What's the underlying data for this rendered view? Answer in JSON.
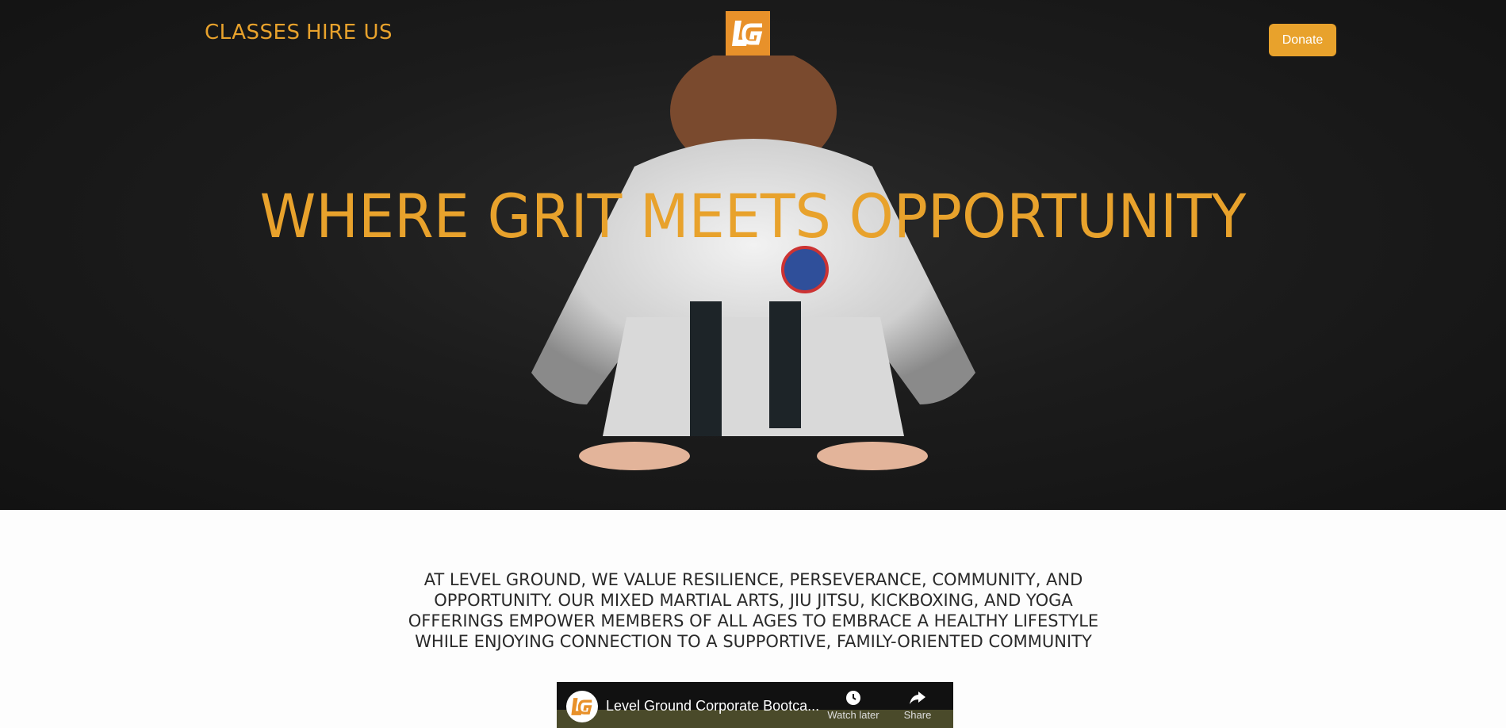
{
  "nav": {
    "classes_label": "CLASSES",
    "hire_label": "HIRE US",
    "donate_label": "Donate"
  },
  "logo": {
    "text": "LG",
    "icon": "lg-logo-icon"
  },
  "hero": {
    "headline": "WHERE GRIT MEETS OPPORTUNITY",
    "image": "martial-artist-bowing"
  },
  "intro": {
    "text": "AT LEVEL GROUND, WE VALUE RESILIENCE, PERSEVERANCE, COMMUNITY, AND OPPORTUNITY. OUR MIXED MARTIAL ARTS, JIU JITSU, KICKBOXING, AND YOGA OFFERINGS EMPOWER MEMBERS OF ALL AGES TO EMBRACE A HEALTHY LIFESTYLE WHILE ENJOYING CONNECTION TO A SUPPORTIVE, FAMILY-ORIENTED COMMUNITY"
  },
  "video": {
    "title": "Level Ground Corporate Bootca...",
    "watch_later_label": "Watch later",
    "share_label": "Share"
  },
  "colors": {
    "accent": "#e8a22c",
    "logo_bg": "#e8912a",
    "hero_bg": "#1c1c1c"
  }
}
